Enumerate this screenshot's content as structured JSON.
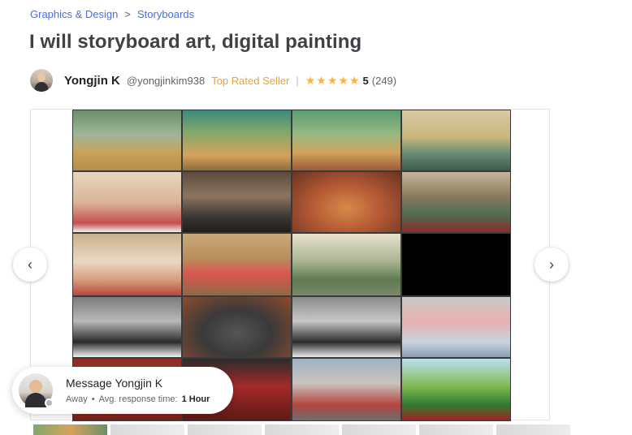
{
  "breadcrumb": {
    "items": [
      "Graphics & Design",
      "Storyboards"
    ],
    "separator": ">"
  },
  "gig": {
    "title": "I will storyboard art, digital painting"
  },
  "seller": {
    "name": "Yongjin K",
    "handle": "@yongjinkim938",
    "level": "Top Rated Seller",
    "divider": "|",
    "stars": [
      "★",
      "★",
      "★",
      "★",
      "★"
    ],
    "star_color": "#ffb33e",
    "rating": "5",
    "reviews": "(249)"
  },
  "gallery": {
    "prev_icon": "‹",
    "next_icon": "›",
    "panels": 20,
    "thumbnail_count": 7
  },
  "message": {
    "title": "Message Yongjin K",
    "status": "Away",
    "bullet": "•",
    "response_label": "Avg. response time:",
    "response_value": "1 Hour"
  },
  "colors": {
    "link": "#446ee7",
    "top_rated": "#e8a13a",
    "title": "#404145"
  }
}
